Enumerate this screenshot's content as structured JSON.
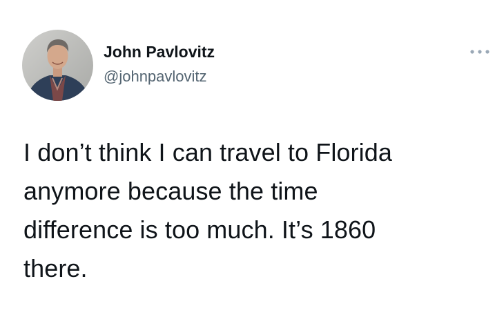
{
  "author": {
    "display_name": "John Pavlovitz",
    "handle": "@johnpavlovitz"
  },
  "tweet": {
    "lines": [
      "I don’t think I can travel to Florida",
      "anymore because the time",
      "difference is too much. It’s 1860",
      "there."
    ]
  },
  "icons": {
    "more": "more-horizontal-icon"
  },
  "colors": {
    "text_primary": "#0f1419",
    "text_secondary": "#536471",
    "icon_muted": "#9aa8b6",
    "background": "#ffffff"
  }
}
